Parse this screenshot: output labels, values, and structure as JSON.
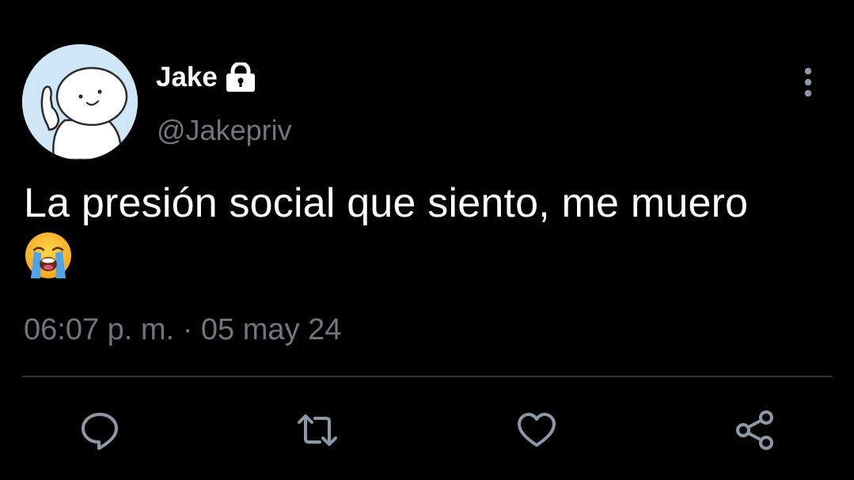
{
  "author": {
    "display_name": "Jake",
    "handle": "@Jakepriv",
    "avatar_icon": "cartoon-character-avatar",
    "protected_icon": "lock-icon"
  },
  "tweet": {
    "text": "La presión social que siento, me muero",
    "emoji_icon": "loudly-crying-face-emoji",
    "time": "06:07 p. m.",
    "separator": "·",
    "date": "05 may 24"
  },
  "actions": {
    "reply_icon": "reply-icon",
    "retweet_icon": "retweet-icon",
    "like_icon": "heart-icon",
    "share_icon": "share-icon",
    "more_icon": "more-vertical-icon"
  },
  "colors": {
    "background": "#000000",
    "primary_text": "#ffffff",
    "secondary_text": "#71767b",
    "divider": "#2f3336",
    "icon": "#8b98a5"
  }
}
